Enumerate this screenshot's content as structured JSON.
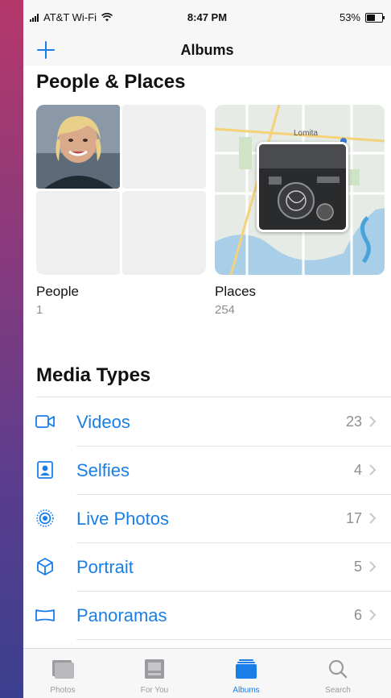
{
  "status_bar": {
    "carrier": "AT&T Wi-Fi",
    "time": "8:47 PM",
    "battery": "53%",
    "battery_level": 0.53
  },
  "nav": {
    "title": "Albums",
    "add_icon": "plus-icon"
  },
  "people_places": {
    "title": "People & Places",
    "people": {
      "label": "People",
      "count": "1"
    },
    "places": {
      "label": "Places",
      "count": "254",
      "map_label": "Lomita"
    }
  },
  "media_types": {
    "title": "Media Types",
    "items": [
      {
        "label": "Videos",
        "count": "23",
        "icon": "video-camera-icon"
      },
      {
        "label": "Selfies",
        "count": "4",
        "icon": "selfie-portrait-icon"
      },
      {
        "label": "Live Photos",
        "count": "17",
        "icon": "live-photo-icon"
      },
      {
        "label": "Portrait",
        "count": "5",
        "icon": "cube-icon"
      },
      {
        "label": "Panoramas",
        "count": "6",
        "icon": "panorama-icon"
      }
    ]
  },
  "tab_bar": {
    "tabs": [
      {
        "label": "Photos",
        "icon": "photos-icon",
        "active": false
      },
      {
        "label": "For You",
        "icon": "for-you-icon",
        "active": false
      },
      {
        "label": "Albums",
        "icon": "albums-icon",
        "active": true
      },
      {
        "label": "Search",
        "icon": "search-icon",
        "active": false
      }
    ]
  },
  "colors": {
    "accent": "#1a7ee8",
    "secondary_text": "#8e8e93",
    "bar_background": "#f7f7f8"
  }
}
